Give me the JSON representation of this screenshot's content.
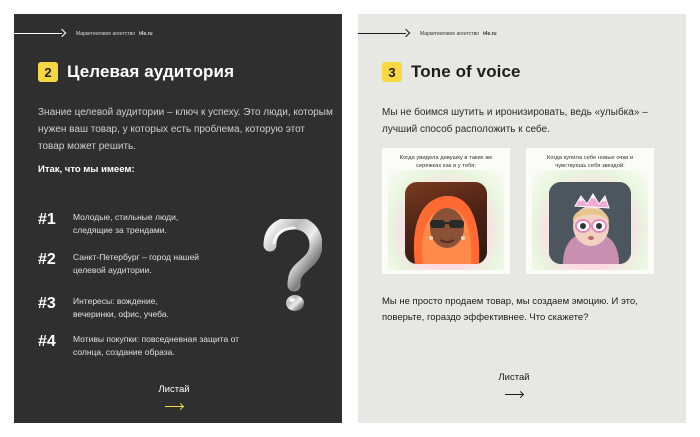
{
  "agency_label": "Маркетинговое агентство",
  "site": "t4e.ru",
  "swipe_label": "Листай",
  "colors": {
    "dark_bg": "#2f2f2f",
    "light_bg": "#e7e7e4",
    "accent": "#f7d842"
  },
  "slide_left": {
    "number": "2",
    "title": "Целевая аудитория",
    "intro": "Знание целевой аудитории – ключ к успеху. Это люди, которым нужен ваш товар, у которых есть проблема, которую этот товар может решить.",
    "subheading": "Итак, что мы имеем:",
    "items": [
      {
        "num": "#1",
        "text": "Молодые, стильные люди, следящие за трендами."
      },
      {
        "num": "#2",
        "text": "Санкт-Петербург – город нашей целевой аудитории."
      },
      {
        "num": "#3",
        "text": "Интересы: вождение, вечеринки, офис, учеба."
      },
      {
        "num": "#4",
        "text": "Мотивы покупки: повседневная защита от солнца, создание образа."
      }
    ],
    "decor_icon": "question-mark-icon"
  },
  "slide_right": {
    "number": "3",
    "title": "Tone of voice",
    "intro": "Мы не боимся шутить и иронизировать, ведь «улыбка» – лучший способ расположить к себе.",
    "memes": [
      {
        "caption": "Когда увидела девушку в таких же сережках как и у тебя:"
      },
      {
        "caption": "Когда купила себе новые очки и чувствуешь себя звездой:"
      }
    ],
    "outro": "Мы не просто продаем товар, мы создаем эмоцию. И это, поверьте, гораздо эффективнее. Что скажете?"
  }
}
